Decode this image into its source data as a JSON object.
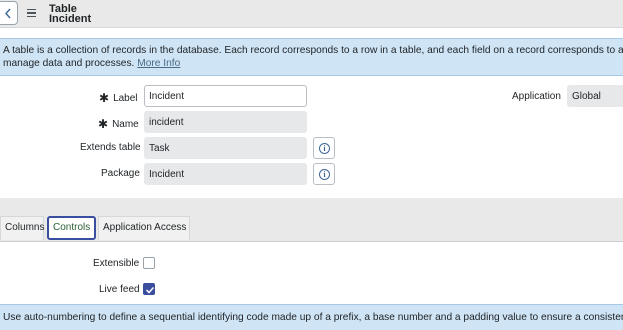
{
  "header": {
    "title_line1": "Table",
    "title_line2": "Incident",
    "back_icon": "chevron-left-icon",
    "menu_icon": "hamburger-menu-icon"
  },
  "info_banner": {
    "text": "A table is a collection of records in the database. Each record corresponds to a row in a table, and each field on a record corresponds to a column on tha",
    "text_line2": "manage data and processes.",
    "link": "More Info"
  },
  "form": {
    "label_field": {
      "label": "Label",
      "value": "Incident",
      "mandatory": true
    },
    "name_field": {
      "label": "Name",
      "value": "incident",
      "mandatory": true
    },
    "extends_field": {
      "label": "Extends table",
      "value": "Task"
    },
    "package_field": {
      "label": "Package",
      "value": "Incident"
    },
    "application_field": {
      "label": "Application",
      "value": "Global"
    },
    "mandatory_marker": "✱"
  },
  "tabs": [
    {
      "label": "Columns",
      "active": false
    },
    {
      "label": "Controls",
      "active": true
    },
    {
      "label": "Application Access",
      "active": false
    }
  ],
  "controls": {
    "extensible": {
      "label": "Extensible",
      "checked": false
    },
    "live_feed": {
      "label": "Live feed",
      "checked": true
    }
  },
  "bottom_banner": {
    "text": "Use auto-numbering to define a sequential identifying code made up of a prefix, a base number and a padding value to ensure a consistent format"
  },
  "colors": {
    "accent": "#3a4ea0",
    "banner": "#cfe4f5",
    "header": "#e9e9e9",
    "active_tab_text": "#2d6138"
  }
}
